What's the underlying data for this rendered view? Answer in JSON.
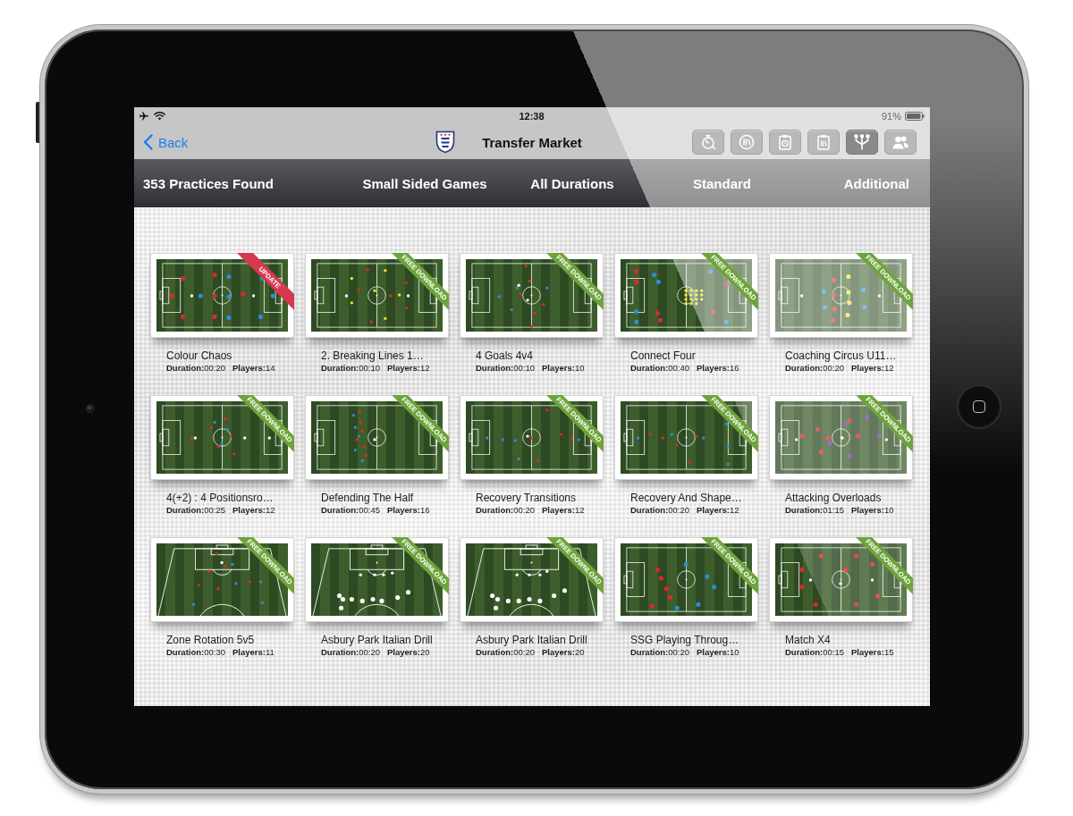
{
  "status_bar": {
    "time": "12:38",
    "battery": "91%"
  },
  "nav_bar": {
    "back": "Back",
    "title": "Transfer Market",
    "tools": [
      {
        "selected": false
      },
      {
        "selected": false
      },
      {
        "selected": false
      },
      {
        "selected": false
      },
      {
        "selected": true
      },
      {
        "selected": false
      }
    ]
  },
  "filter_bar": {
    "count": "353 Practices Found",
    "filters": [
      "Small Sided Games",
      "All Durations",
      "Standard",
      "Additional"
    ]
  },
  "practices": [
    {
      "title": "Colour Chaos",
      "duration": "**Duration:**00:20",
      "players": "**Players:**14",
      "kind": "full-pitch",
      "ribbon": {
        "label": "UPDATE",
        "color": "#d8384f"
      }
    },
    {
      "title": "2. Breaking Lines 1…",
      "duration": "**Duration:**00:10",
      "players": "**Players:**12",
      "kind": "full-pitch",
      "ribbon": {
        "label": "FREE DOWNLOAD",
        "color": "#6ea43c"
      }
    },
    {
      "title": "4 Goals 4v4",
      "duration": "**Duration:**00:10",
      "players": "**Players:**10",
      "kind": "full-pitch",
      "ribbon": {
        "label": "FREE DOWNLOAD",
        "color": "#6ea43c"
      }
    },
    {
      "title": "Connect Four",
      "duration": "**Duration:**00:40",
      "players": "**Players:**16",
      "kind": "full-pitch",
      "ribbon": {
        "label": "FREE DOWNLOAD",
        "color": "#6ea43c"
      }
    },
    {
      "title": "Coaching Circus U11…",
      "duration": "**Duration:**00:20",
      "players": "**Players:**12",
      "kind": "full-pitch",
      "ribbon": {
        "label": "FREE DOWNLOAD",
        "color": "#6ea43c"
      }
    },
    {
      "title": "4(+2) : 4 Positionsro…",
      "duration": "**Duration:**00:25",
      "players": "**Players:**12",
      "kind": "full-pitch",
      "ribbon": {
        "label": "FREE DOWNLOAD",
        "color": "#6ea43c"
      }
    },
    {
      "title": "Defending The Half",
      "duration": "**Duration:**00:45",
      "players": "**Players:**16",
      "kind": "full-pitch",
      "ribbon": {
        "label": "FREE DOWNLOAD",
        "color": "#6ea43c"
      }
    },
    {
      "title": "Recovery Transitions",
      "duration": "**Duration:**00:20",
      "players": "**Players:**12",
      "kind": "full-pitch",
      "ribbon": {
        "label": "FREE DOWNLOAD",
        "color": "#6ea43c"
      }
    },
    {
      "title": "Recovery And Shape…",
      "duration": "**Duration:**00:20",
      "players": "**Players:**12",
      "kind": "full-pitch",
      "ribbon": {
        "label": "FREE DOWNLOAD",
        "color": "#6ea43c"
      }
    },
    {
      "title": "Attacking Overloads",
      "duration": "**Duration:**01:15",
      "players": "**Players:**10",
      "kind": "full-pitch",
      "ribbon": {
        "label": "FREE DOWNLOAD",
        "color": "#6ea43c"
      }
    },
    {
      "title": "Zone Rotation 5v5",
      "duration": "**Duration:**00:30",
      "players": "**Players:**11",
      "kind": "half-pitch",
      "ribbon": {
        "label": "FREE DOWNLOAD",
        "color": "#6ea43c"
      }
    },
    {
      "title": "Asbury Park Italian Drill",
      "duration": "**Duration:**00:20",
      "players": "**Players:**20",
      "kind": "half-pitch",
      "ribbon": {
        "label": "FREE DOWNLOAD",
        "color": "#6ea43c"
      }
    },
    {
      "title": "Asbury Park Italian Drill",
      "duration": "**Duration:**00:20",
      "players": "**Players:**20",
      "kind": "half-pitch",
      "ribbon": {
        "label": "FREE DOWNLOAD",
        "color": "#6ea43c"
      }
    },
    {
      "title": "SSG Playing Throug…",
      "duration": "**Duration:**00:20",
      "players": "**Players:**10",
      "kind": "full-pitch",
      "ribbon": {
        "label": "FREE DOWNLOAD",
        "color": "#6ea43c"
      }
    },
    {
      "title": "Match X4",
      "duration": "**Duration:**00:15",
      "players": "**Players:**15",
      "kind": "full-pitch",
      "ribbon": {
        "label": "FREE DOWNLOAD",
        "color": "#6ea43c"
      }
    }
  ]
}
